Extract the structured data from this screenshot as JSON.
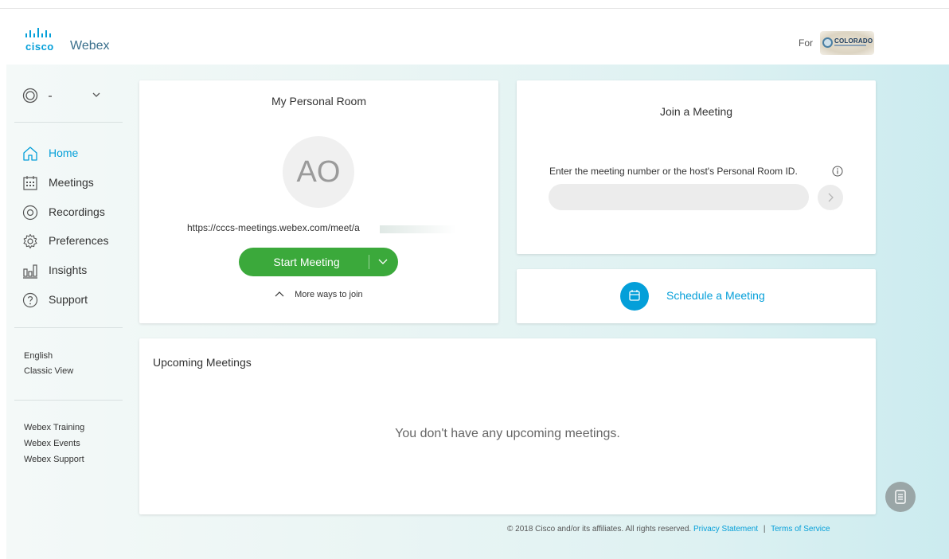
{
  "header": {
    "logo_brand": "cisco",
    "logo_product": "Webex",
    "for_label": "For",
    "org_name": "COLORADO"
  },
  "sidebar": {
    "user_menu_icon": "user-circle-icon",
    "nav": [
      {
        "label": "Home",
        "icon": "home-icon",
        "active": true
      },
      {
        "label": "Meetings",
        "icon": "calendar-icon"
      },
      {
        "label": "Recordings",
        "icon": "record-icon"
      },
      {
        "label": "Preferences",
        "icon": "gear-icon"
      },
      {
        "label": "Insights",
        "icon": "insights-icon"
      },
      {
        "label": "Support",
        "icon": "help-icon"
      }
    ],
    "language": "English",
    "classic_view": "Classic View",
    "links": [
      "Webex Training",
      "Webex Events",
      "Webex Support"
    ]
  },
  "personal_room": {
    "title": "My Personal Room",
    "avatar_initials": "AO",
    "url": "https://cccs-meetings.webex.com/meet/a",
    "start_label": "Start Meeting",
    "more_ways": "More ways to join"
  },
  "join": {
    "title": "Join a Meeting",
    "help": "Enter the meeting number or the host's Personal Room ID.",
    "input_value": "",
    "input_placeholder": ""
  },
  "schedule": {
    "label": "Schedule a Meeting"
  },
  "upcoming": {
    "title": "Upcoming Meetings",
    "empty_message": "You don't have any upcoming meetings."
  },
  "footer": {
    "copyright": "© 2018 Cisco and/or its affiliates. All rights reserved.",
    "privacy": "Privacy Statement",
    "separator": "|",
    "terms": "Terms of Service"
  },
  "colors": {
    "accent": "#049fd9",
    "start_green": "#3ba93b"
  }
}
